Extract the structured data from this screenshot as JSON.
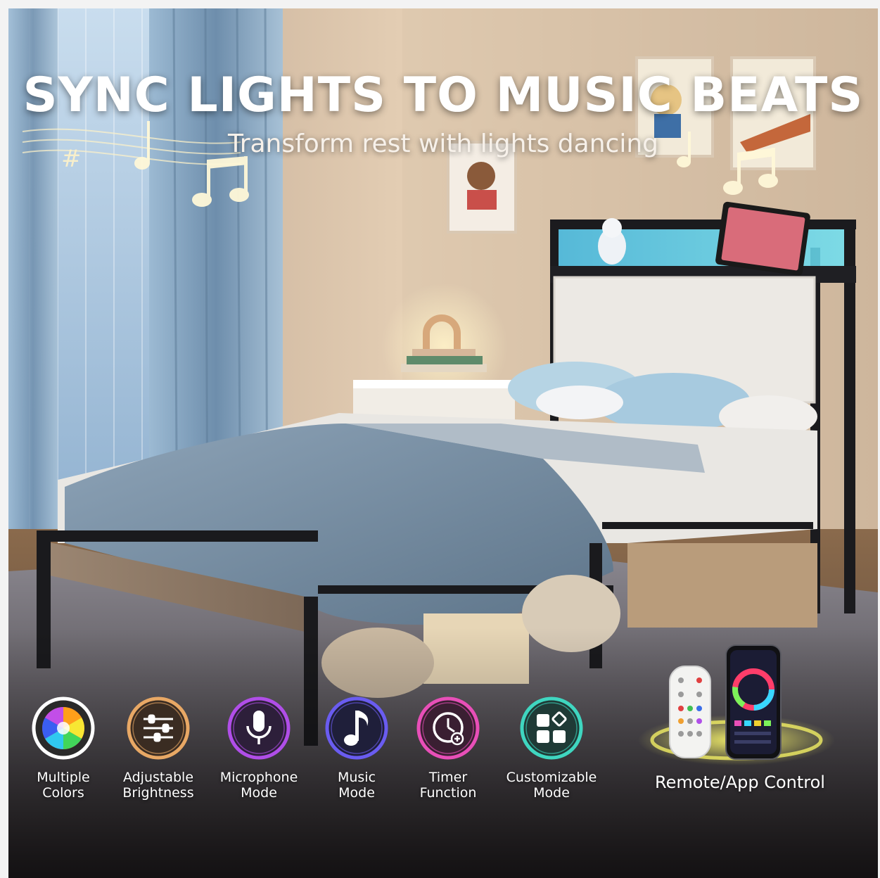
{
  "headline": "SYNC LIGHTS TO MUSIC BEATS",
  "subline": "Transform rest with lights dancing",
  "features": [
    {
      "line1": "Multiple",
      "line2": "Colors",
      "icon": "color-wheel-icon",
      "color": "#ffffff"
    },
    {
      "line1": "Adjustable",
      "line2": "Brightness",
      "icon": "sliders-icon",
      "color": "#e8a865"
    },
    {
      "line1": "Microphone",
      "line2": "Mode",
      "icon": "microphone-icon",
      "color": "#b04ee8"
    },
    {
      "line1": "Music",
      "line2": "Mode",
      "icon": "music-note-icon",
      "color": "#6a5cf0"
    },
    {
      "line1": "Timer",
      "line2": "Function",
      "icon": "timer-icon",
      "color": "#e84fb8"
    },
    {
      "line1": "Customizable",
      "line2": "Mode",
      "icon": "custom-mode-icon",
      "color": "#3fd6c0"
    }
  ],
  "remote_label": "Remote/App Control",
  "colors": {
    "headboard_light": "#49c8e8",
    "wall": "#cbb39a",
    "curtain": "#7ea3c4",
    "blanket": "#7d93a6"
  }
}
